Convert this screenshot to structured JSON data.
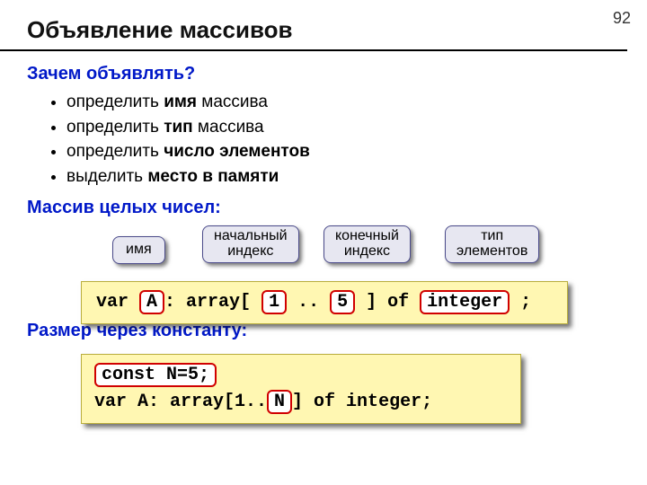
{
  "page_number": "92",
  "title": "Объявление массивов",
  "why": {
    "heading": "Зачем объявлять?",
    "b1_pre": "определить ",
    "b1_bold": "имя",
    "b1_post": " массива",
    "b2_pre": "определить ",
    "b2_bold": "тип",
    "b2_post": " массива",
    "b3_pre": "определить ",
    "b3_bold": "число элементов",
    "b3_post": "",
    "b4_pre": "выделить ",
    "b4_bold": "место в памяти",
    "b4_post": ""
  },
  "intarr": {
    "heading": "Массив целых чисел:",
    "labels": {
      "name": "имя",
      "start_l1": "начальный",
      "start_l2": "индекс",
      "end_l1": "конечный",
      "end_l2": "индекс",
      "type_l1": "тип",
      "type_l2": "элементов"
    },
    "code": {
      "t1": "var ",
      "hl1": "A",
      "t2": ": array[",
      "hl2": "1",
      "t3": " .. ",
      "hl3": "5",
      "t4": " ] of ",
      "hl4": "integer",
      "t5": " ;"
    }
  },
  "viaconst": {
    "heading": "Размер через константу:",
    "code": {
      "hl1": "const N=5;",
      "line2_a": "var A: array[1..",
      "hl2": "N",
      "line2_b": "] of integer;"
    }
  }
}
